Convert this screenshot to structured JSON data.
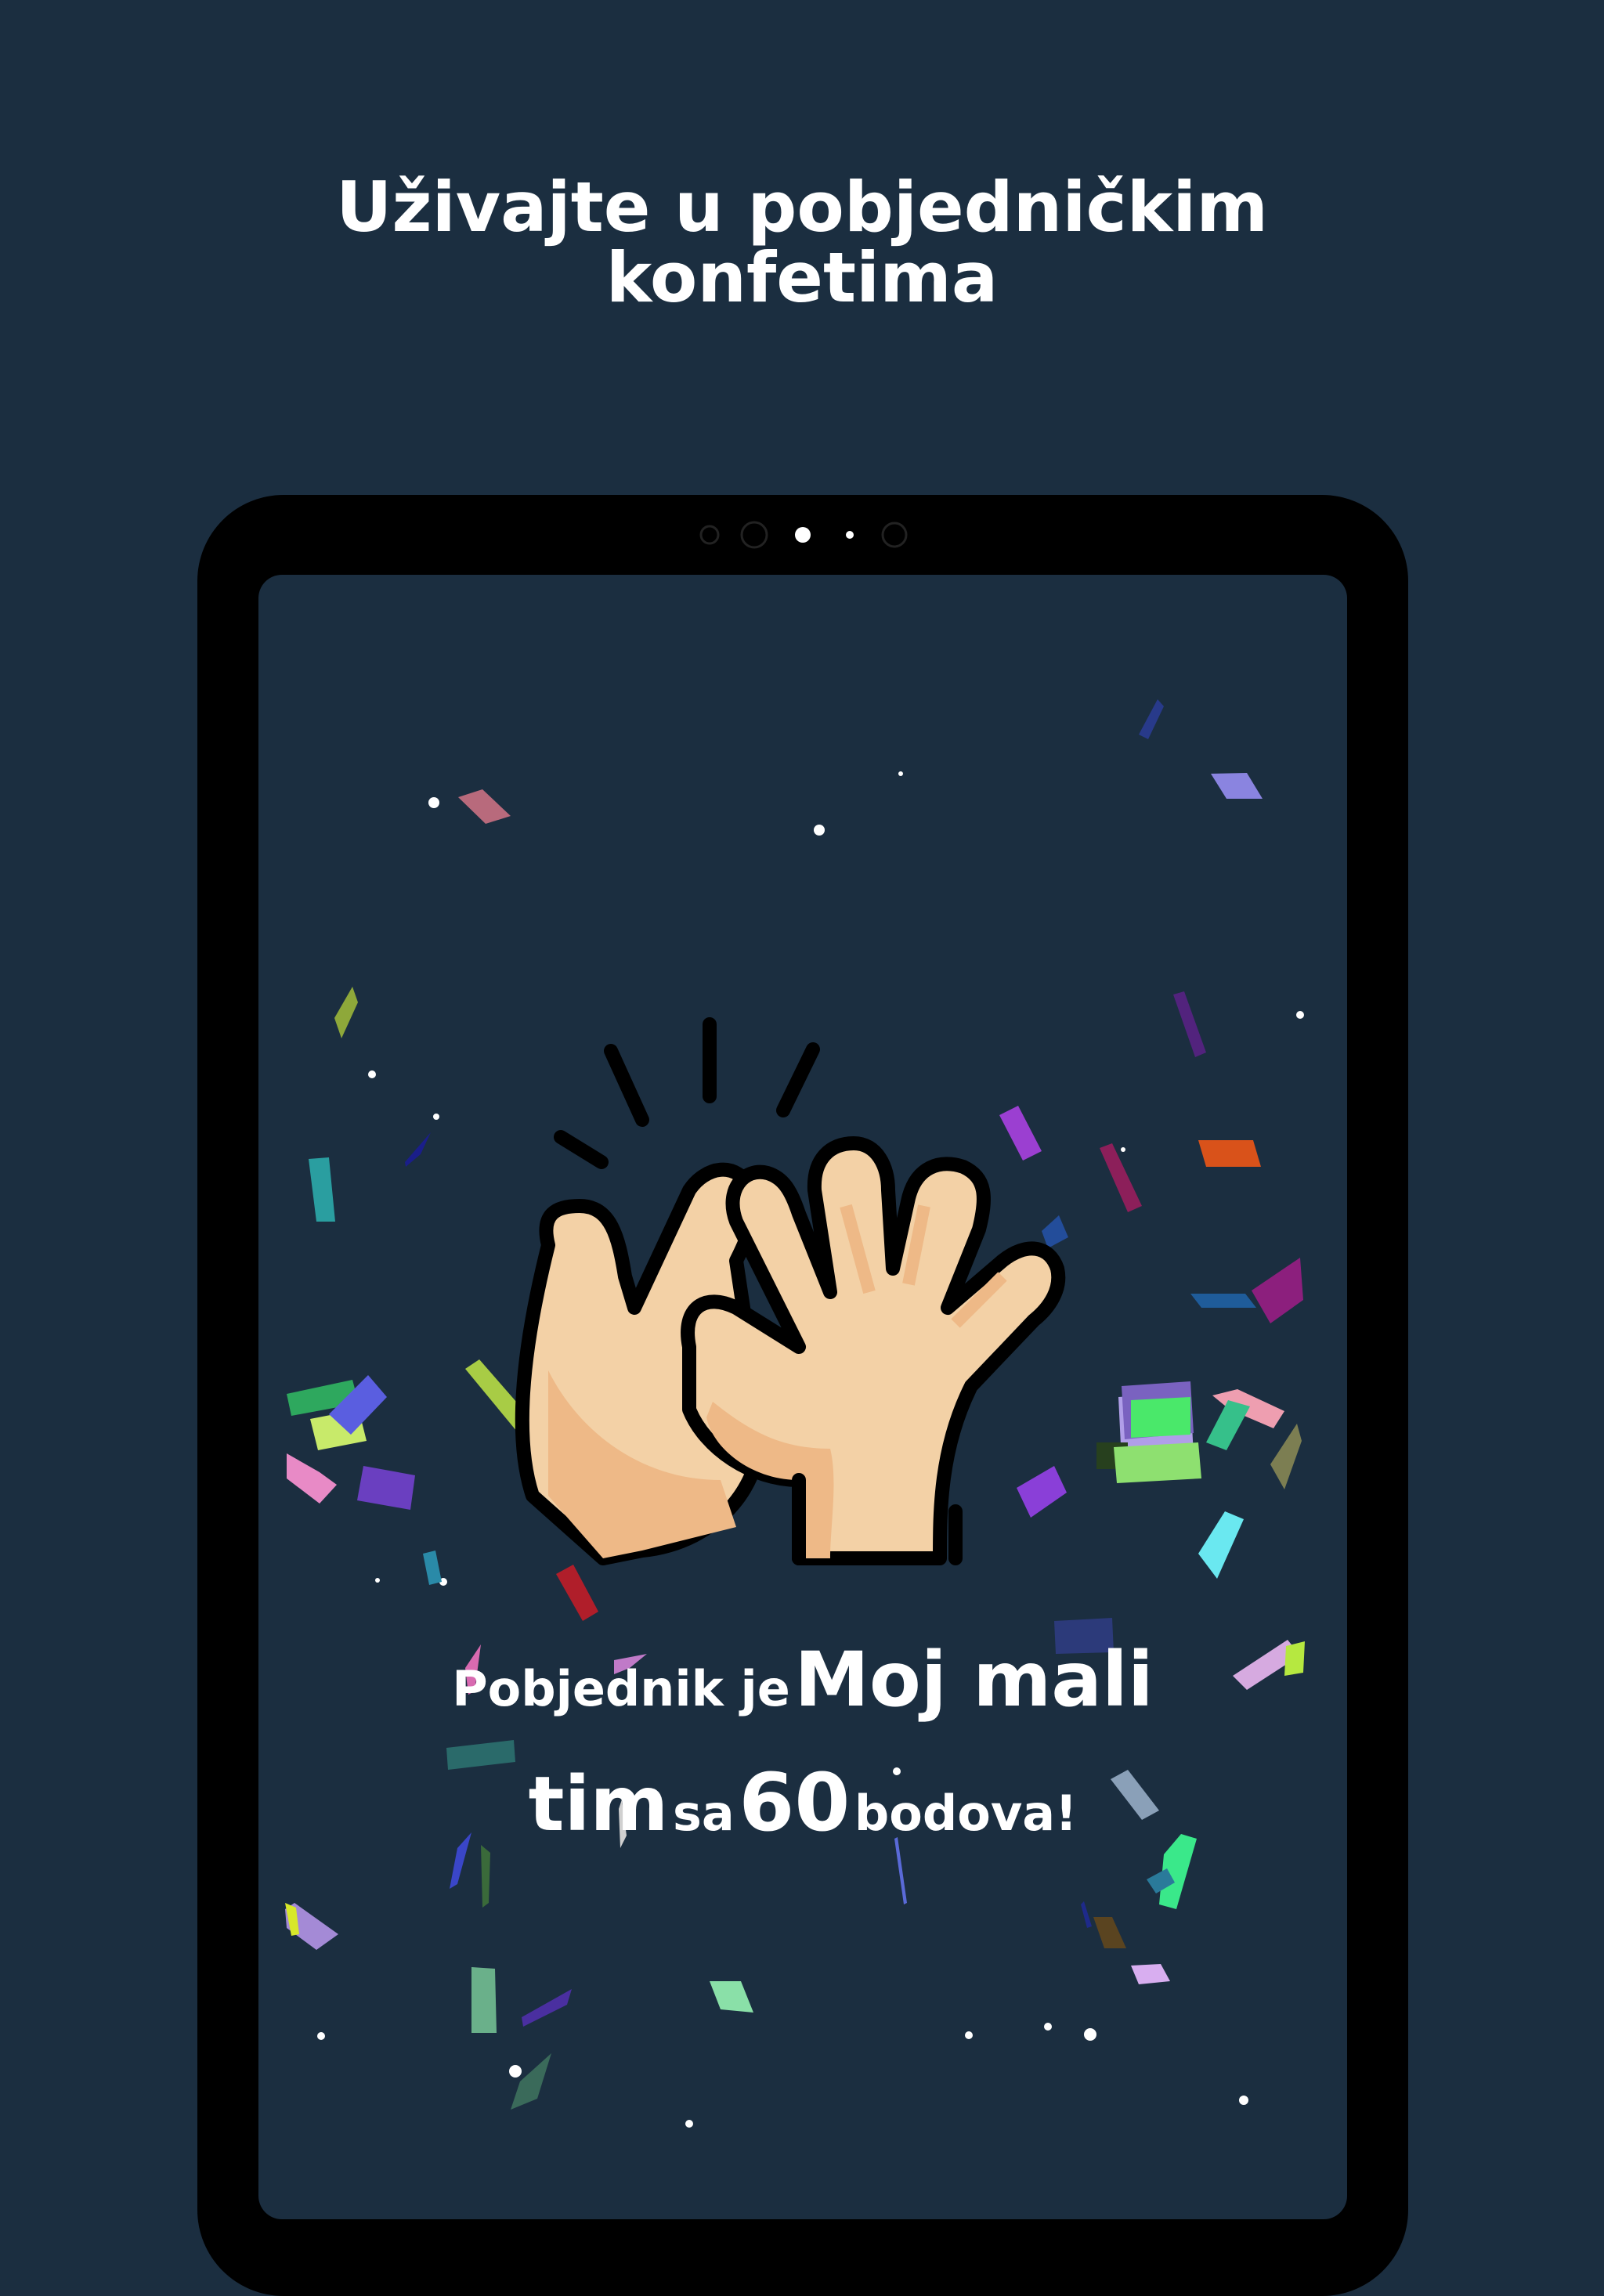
{
  "headline": {
    "line1": "Uživajte u pobjedničkim",
    "line2": "konfetima"
  },
  "winner": {
    "prefix": "Pobjednik je",
    "team": "Moj mali",
    "team_end": "tim",
    "mid": "sa",
    "points": "60",
    "suffix": "bodova!"
  },
  "illustration": {
    "icon": "high-five-icon"
  },
  "colors": {
    "background": "#1b2e40",
    "device_frame": "#000000",
    "skin_light": "#f3d1a6",
    "skin_shadow": "#eeb987",
    "text": "#ffffff"
  }
}
